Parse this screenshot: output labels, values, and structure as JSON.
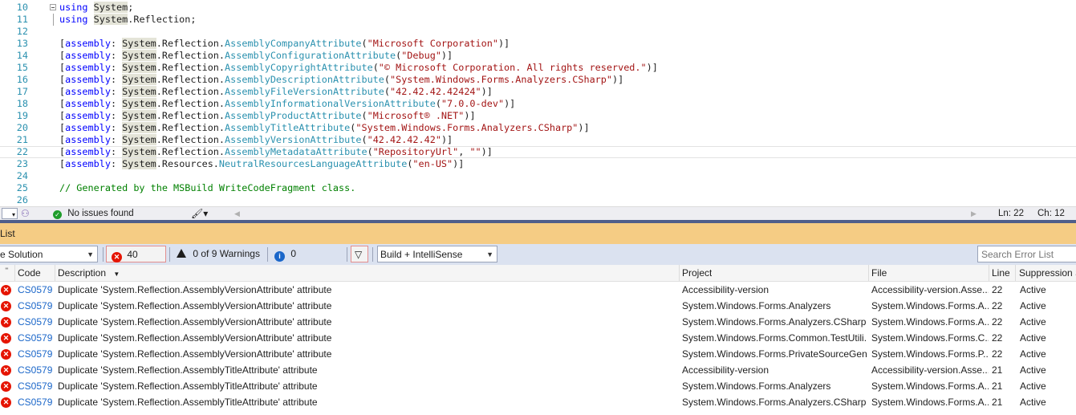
{
  "editor": {
    "lines": [
      {
        "n": "10",
        "parts": [
          [
            "kw",
            "using"
          ],
          [
            "",
            ""
          ],
          [
            "",
            " "
          ],
          [
            "hl",
            "System"
          ],
          [
            "",
            ";"
          ]
        ]
      },
      {
        "n": "11",
        "parts": [
          [
            "kw",
            "using"
          ],
          [
            "",
            " "
          ],
          [
            "hl",
            "System"
          ],
          [
            "",
            ".Reflection;"
          ]
        ]
      },
      {
        "n": "12",
        "parts": []
      },
      {
        "n": "13",
        "parts": [
          [
            "",
            "["
          ],
          [
            "kw",
            "assembly"
          ],
          [
            "",
            ": "
          ],
          [
            "hl",
            "System"
          ],
          [
            "",
            ".Reflection."
          ],
          [
            "ty",
            "AssemblyCompanyAttribute"
          ],
          [
            "",
            "("
          ],
          [
            "str",
            "\"Microsoft Corporation\""
          ],
          [
            "",
            ")]"
          ]
        ]
      },
      {
        "n": "14",
        "parts": [
          [
            "",
            "["
          ],
          [
            "kw",
            "assembly"
          ],
          [
            "",
            ": "
          ],
          [
            "hl",
            "System"
          ],
          [
            "",
            ".Reflection."
          ],
          [
            "ty",
            "AssemblyConfigurationAttribute"
          ],
          [
            "",
            "("
          ],
          [
            "str",
            "\"Debug\""
          ],
          [
            "",
            ")]"
          ]
        ]
      },
      {
        "n": "15",
        "parts": [
          [
            "",
            "["
          ],
          [
            "kw",
            "assembly"
          ],
          [
            "",
            ": "
          ],
          [
            "hl",
            "System"
          ],
          [
            "",
            ".Reflection."
          ],
          [
            "ty",
            "AssemblyCopyrightAttribute"
          ],
          [
            "",
            "("
          ],
          [
            "str",
            "\"© Microsoft Corporation. All rights reserved.\""
          ],
          [
            "",
            ")]"
          ]
        ]
      },
      {
        "n": "16",
        "parts": [
          [
            "",
            "["
          ],
          [
            "kw",
            "assembly"
          ],
          [
            "",
            ": "
          ],
          [
            "hl",
            "System"
          ],
          [
            "",
            ".Reflection."
          ],
          [
            "ty",
            "AssemblyDescriptionAttribute"
          ],
          [
            "",
            "("
          ],
          [
            "str",
            "\"System.Windows.Forms.Analyzers.CSharp\""
          ],
          [
            "",
            ")]"
          ]
        ]
      },
      {
        "n": "17",
        "parts": [
          [
            "",
            "["
          ],
          [
            "kw",
            "assembly"
          ],
          [
            "",
            ": "
          ],
          [
            "hl",
            "System"
          ],
          [
            "",
            ".Reflection."
          ],
          [
            "ty",
            "AssemblyFileVersionAttribute"
          ],
          [
            "",
            "("
          ],
          [
            "str",
            "\"42.42.42.42424\""
          ],
          [
            "",
            ")]"
          ]
        ]
      },
      {
        "n": "18",
        "parts": [
          [
            "",
            "["
          ],
          [
            "kw",
            "assembly"
          ],
          [
            "",
            ": "
          ],
          [
            "hl",
            "System"
          ],
          [
            "",
            ".Reflection."
          ],
          [
            "ty",
            "AssemblyInformationalVersionAttribute"
          ],
          [
            "",
            "("
          ],
          [
            "str",
            "\"7.0.0-dev\""
          ],
          [
            "",
            ")]"
          ]
        ]
      },
      {
        "n": "19",
        "parts": [
          [
            "",
            "["
          ],
          [
            "kw",
            "assembly"
          ],
          [
            "",
            ": "
          ],
          [
            "hl",
            "System"
          ],
          [
            "",
            ".Reflection."
          ],
          [
            "ty",
            "AssemblyProductAttribute"
          ],
          [
            "",
            "("
          ],
          [
            "str",
            "\"Microsoft® .NET\""
          ],
          [
            "",
            ")]"
          ]
        ]
      },
      {
        "n": "20",
        "parts": [
          [
            "",
            "["
          ],
          [
            "kw",
            "assembly"
          ],
          [
            "",
            ": "
          ],
          [
            "hl",
            "System"
          ],
          [
            "",
            ".Reflection."
          ],
          [
            "ty",
            "AssemblyTitleAttribute"
          ],
          [
            "",
            "("
          ],
          [
            "str",
            "\"System.Windows.Forms.Analyzers.CSharp\""
          ],
          [
            "",
            ")]"
          ]
        ]
      },
      {
        "n": "21",
        "parts": [
          [
            "",
            "["
          ],
          [
            "kw",
            "assembly"
          ],
          [
            "",
            ": "
          ],
          [
            "hl",
            "System"
          ],
          [
            "",
            ".Reflection."
          ],
          [
            "ty",
            "AssemblyVersionAttribute"
          ],
          [
            "",
            "("
          ],
          [
            "str",
            "\"42.42.42.42\""
          ],
          [
            "",
            ")]"
          ]
        ]
      },
      {
        "n": "22",
        "parts": [
          [
            "",
            "["
          ],
          [
            "kw",
            "assembly"
          ],
          [
            "",
            ": "
          ],
          [
            "hl",
            "System"
          ],
          [
            "",
            ".Reflection."
          ],
          [
            "ty",
            "AssemblyMetadataAttribute"
          ],
          [
            "",
            "("
          ],
          [
            "str",
            "\"RepositoryUrl\""
          ],
          [
            "",
            ", "
          ],
          [
            "str",
            "\"\""
          ],
          [
            "",
            ")]"
          ]
        ],
        "current": true
      },
      {
        "n": "23",
        "parts": [
          [
            "",
            "["
          ],
          [
            "kw",
            "assembly"
          ],
          [
            "",
            ": "
          ],
          [
            "hl",
            "System"
          ],
          [
            "",
            ".Resources."
          ],
          [
            "ty",
            "NeutralResourcesLanguageAttribute"
          ],
          [
            "",
            "("
          ],
          [
            "str",
            "\"en-US\""
          ],
          [
            "",
            ")]"
          ]
        ]
      },
      {
        "n": "24",
        "parts": []
      },
      {
        "n": "25",
        "parts": [
          [
            "cm",
            "// Generated by the MSBuild WriteCodeFragment class."
          ]
        ]
      },
      {
        "n": "26",
        "parts": []
      }
    ]
  },
  "status_strip": {
    "issues": "No issues found",
    "line": "Ln: 22",
    "col": "Ch: 12"
  },
  "error_list": {
    "title": "List",
    "scope": "e Solution",
    "errors_label": "40 Errors",
    "warnings_label": "0 of 9 Warnings",
    "messages_label": "0 Messages",
    "build_filter": "Build + IntelliSense",
    "search_placeholder": "Search Error List",
    "columns": {
      "code": "Code",
      "description": "Description",
      "project": "Project",
      "file": "File",
      "line": "Line",
      "suppression": "Suppression S"
    },
    "rows": [
      {
        "code": "CS0579",
        "description": "Duplicate 'System.Reflection.AssemblyVersionAttribute' attribute",
        "project": "Accessibility-version",
        "file": "Accessibility-version.Asse...",
        "line": "22",
        "suppression": "Active"
      },
      {
        "code": "CS0579",
        "description": "Duplicate 'System.Reflection.AssemblyVersionAttribute' attribute",
        "project": "System.Windows.Forms.Analyzers",
        "file": "System.Windows.Forms.A...",
        "line": "22",
        "suppression": "Active"
      },
      {
        "code": "CS0579",
        "description": "Duplicate 'System.Reflection.AssemblyVersionAttribute' attribute",
        "project": "System.Windows.Forms.Analyzers.CSharp",
        "file": "System.Windows.Forms.A...",
        "line": "22",
        "suppression": "Active"
      },
      {
        "code": "CS0579",
        "description": "Duplicate 'System.Reflection.AssemblyVersionAttribute' attribute",
        "project": "System.Windows.Forms.Common.TestUtili...",
        "file": "System.Windows.Forms.C...",
        "line": "22",
        "suppression": "Active"
      },
      {
        "code": "CS0579",
        "description": "Duplicate 'System.Reflection.AssemblyVersionAttribute' attribute",
        "project": "System.Windows.Forms.PrivateSourceGen...",
        "file": "System.Windows.Forms.P...",
        "line": "22",
        "suppression": "Active"
      },
      {
        "code": "CS0579",
        "description": "Duplicate 'System.Reflection.AssemblyTitleAttribute' attribute",
        "project": "Accessibility-version",
        "file": "Accessibility-version.Asse...",
        "line": "21",
        "suppression": "Active"
      },
      {
        "code": "CS0579",
        "description": "Duplicate 'System.Reflection.AssemblyTitleAttribute' attribute",
        "project": "System.Windows.Forms.Analyzers",
        "file": "System.Windows.Forms.A...",
        "line": "21",
        "suppression": "Active"
      },
      {
        "code": "CS0579",
        "description": "Duplicate 'System.Reflection.AssemblyTitleAttribute' attribute",
        "project": "System.Windows.Forms.Analyzers.CSharp",
        "file": "System.Windows.Forms.A...",
        "line": "21",
        "suppression": "Active"
      }
    ]
  }
}
